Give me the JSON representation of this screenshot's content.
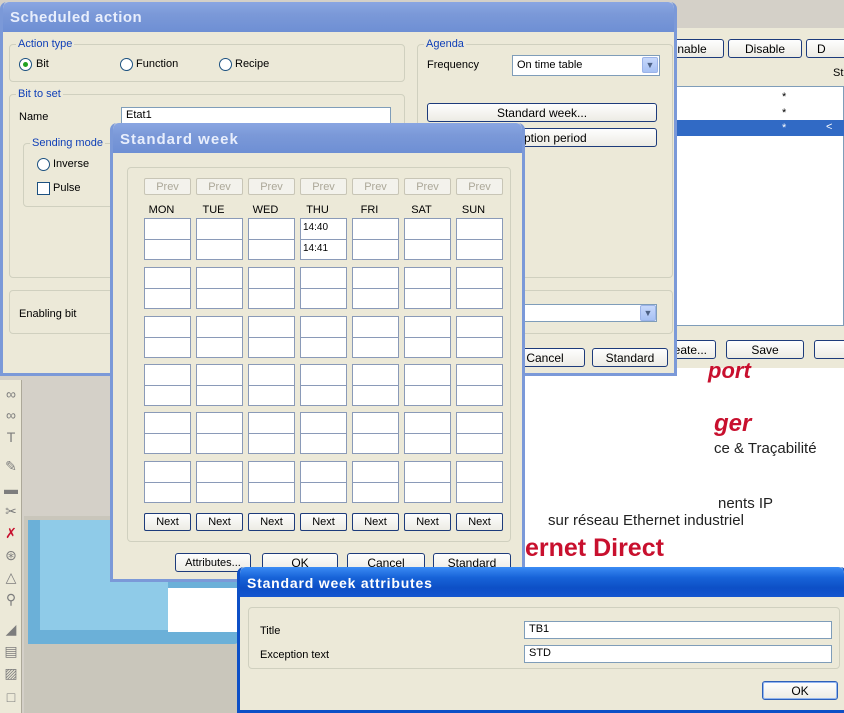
{
  "scheduled_action": {
    "title": "Scheduled action",
    "action_type_label": "Action type",
    "action_types": [
      "Bit",
      "Function",
      "Recipe"
    ],
    "bit_to_set_label": "Bit to set",
    "name_label": "Name",
    "name_value": "Etat1",
    "sending_mode_label": "Sending mode",
    "inverse_label": "Inverse",
    "pulse_label": "Pulse",
    "enabling_bit_label": "Enabling bit",
    "agenda_label": "Agenda",
    "frequency_label": "Frequency",
    "frequency_value": "On time table",
    "standard_week_button": "Standard week...",
    "exception_period_button": "Exception period",
    "cancel_button": "Cancel",
    "standard_button": "Standard"
  },
  "background_window": {
    "buttons_top": [
      "Enable",
      "Disable",
      "D"
    ],
    "col_header": "St",
    "rows": [
      {
        "star": "*",
        "arrow": ""
      },
      {
        "star": "*",
        "arrow": ""
      },
      {
        "star": "*",
        "arrow": "<"
      }
    ],
    "buttons_bottom": [
      "Create...",
      "Save",
      ""
    ],
    "promo_lines": [
      "port",
      "ger",
      "ce & Traçabilité",
      "nents IP",
      "sur réseau Ethernet industriel",
      "ernet Direct"
    ]
  },
  "standard_week": {
    "title": "Standard week",
    "prev_label": "Prev",
    "next_label": "Next",
    "days": [
      "MON",
      "TUE",
      "WED",
      "THU",
      "FRI",
      "SAT",
      "SUN"
    ],
    "entries": {
      "thu_1": "14:40",
      "thu_2": "14:41"
    },
    "attributes_button": "Attributes...",
    "ok_button": "OK",
    "cancel_button": "Cancel",
    "standard_button": "Standard"
  },
  "attributes": {
    "title": "Standard week attributes",
    "title_label": "Title",
    "title_value": "TB1",
    "exception_label": "Exception text",
    "exception_value": "STD",
    "ok_button": "OK"
  },
  "colors": {
    "xp_title": "#0d4fc6",
    "dialog_bg": "#ece9d8",
    "accent_red": "#c8102e",
    "selection": "#316ac5"
  }
}
